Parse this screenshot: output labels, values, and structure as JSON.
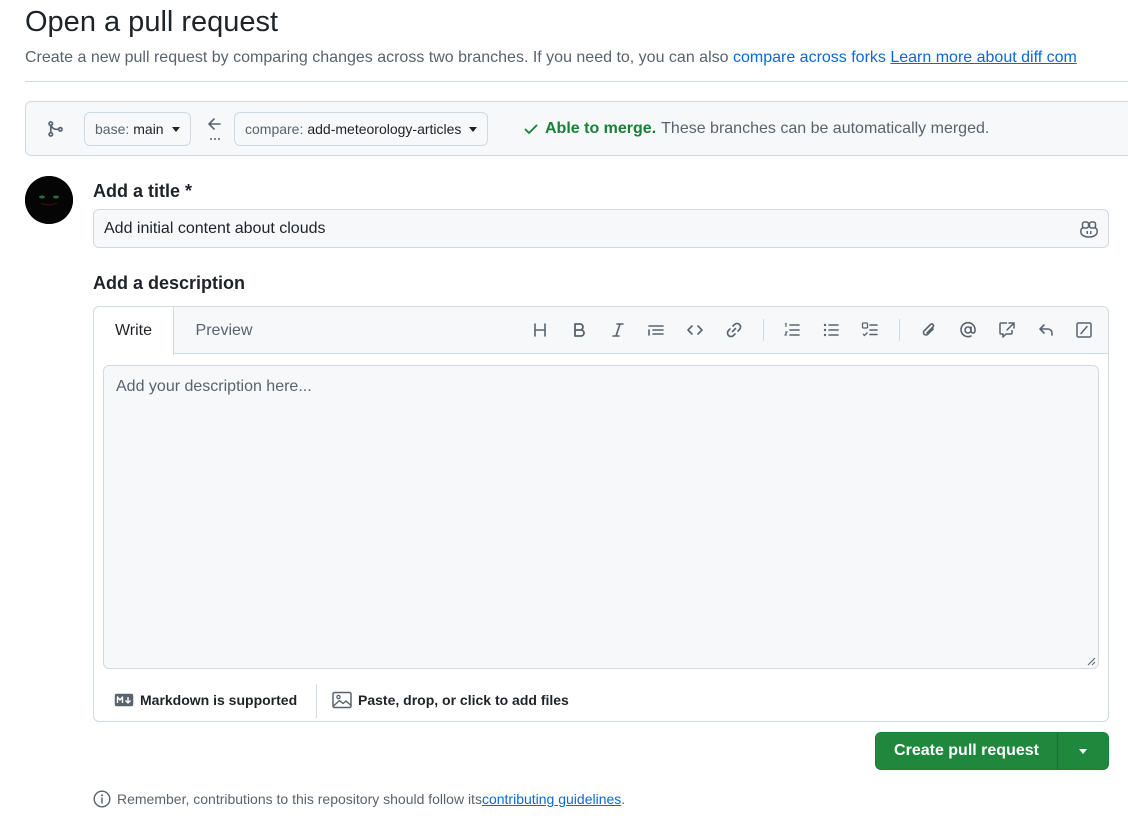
{
  "header": {
    "title": "Open a pull request",
    "subtitle_text": "Create a new pull request by comparing changes across two branches. If you need to, you can also ",
    "compare_forks_link": "compare across forks",
    "learn_more_link": "Learn more about diff com"
  },
  "range": {
    "base_prefix": "base:",
    "base_branch": "main",
    "compare_prefix": "compare:",
    "compare_branch": "add-meteorology-articles",
    "merge_ok": "Able to merge.",
    "merge_rest": "These branches can be automatically merged."
  },
  "form": {
    "title_label": "Add a title",
    "required_mark": "*",
    "title_value": "Add initial content about clouds",
    "description_label": "Add a description",
    "tabs": [
      "Write",
      "Preview"
    ],
    "description_placeholder": "Add your description here...",
    "markdown_note": "Markdown is supported",
    "attach_note": "Paste, drop, or click to add files"
  },
  "toolbar_icons": [
    "heading-icon",
    "bold-icon",
    "italic-icon",
    "quote-icon",
    "code-icon",
    "link-icon",
    "numbered-list-icon",
    "bulleted-list-icon",
    "task-list-icon",
    "attach-icon",
    "mention-icon",
    "cross-reference-icon",
    "reply-icon",
    "slash-command-icon"
  ],
  "actions": {
    "create_label": "Create pull request"
  },
  "footer": {
    "note_text": "Remember, contributions to this repository should follow its ",
    "guidelines_link": "contributing guidelines",
    "note_end": "."
  },
  "colors": {
    "accent": "#0969da",
    "success": "#1a7f37",
    "primary_button": "#1f883d"
  }
}
